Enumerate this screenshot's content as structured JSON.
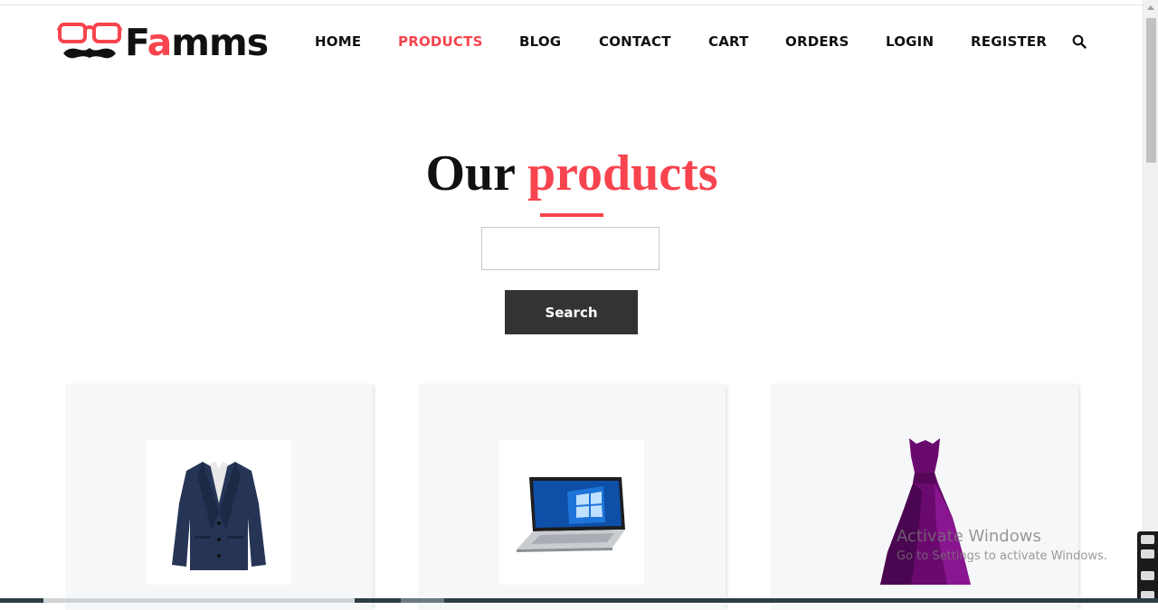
{
  "brand": {
    "logo_text_pre": "F",
    "logo_text_accent": "a",
    "logo_text_post": "mms",
    "accent_color": "#f7444e"
  },
  "nav": {
    "items": [
      {
        "label": "HOME"
      },
      {
        "label": "PRODUCTS",
        "active": true
      },
      {
        "label": "BLOG"
      },
      {
        "label": "CONTACT"
      },
      {
        "label": "CART"
      },
      {
        "label": "ORDERS"
      },
      {
        "label": "LOGIN"
      },
      {
        "label": "REGISTER"
      }
    ],
    "search_icon": "search-icon"
  },
  "heading": {
    "prefix": "Our",
    "accent": "products"
  },
  "search": {
    "value": "",
    "placeholder": "",
    "button_label": "Search"
  },
  "products": [
    {
      "image": "jacket"
    },
    {
      "image": "laptop"
    },
    {
      "image": "dress"
    }
  ],
  "watermark": {
    "title": "Activate Windows",
    "subtitle": "Go to Settings to activate Windows."
  }
}
